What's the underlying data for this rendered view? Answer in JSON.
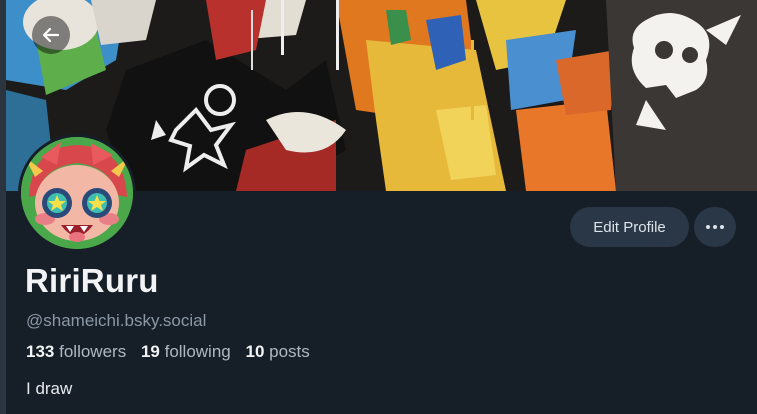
{
  "profile": {
    "display_name": "RiriRuru",
    "handle": "@shameichi.bsky.social",
    "followers_count": "133",
    "followers_label": "followers",
    "following_count": "19",
    "following_label": "following",
    "posts_count": "10",
    "posts_label": "posts",
    "bio": "I draw"
  },
  "actions": {
    "edit_profile_label": "Edit Profile",
    "more_icon": "ellipsis-icon",
    "back_icon": "arrow-left-icon"
  },
  "colors": {
    "background": "#161e27",
    "button_bg": "#2a3746",
    "text_primary": "#f1f3f5",
    "text_secondary": "#8b98a6"
  }
}
